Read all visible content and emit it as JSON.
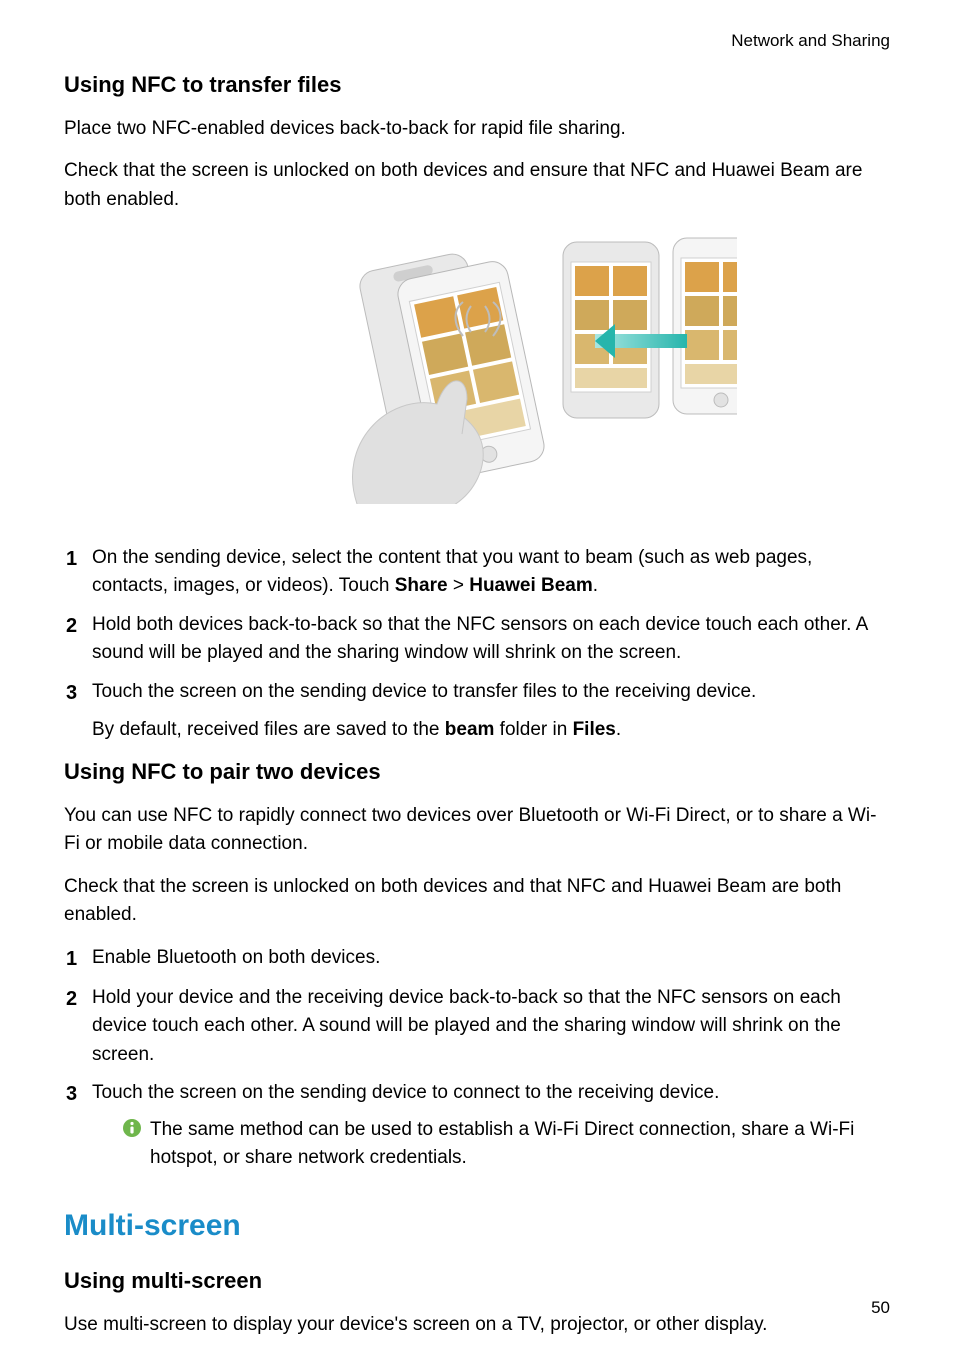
{
  "header": {
    "section": "Network and Sharing"
  },
  "page_number": "50",
  "section1": {
    "heading": "Using NFC to transfer files",
    "p1": "Place two NFC-enabled devices back-to-back for rapid file sharing.",
    "p2": "Check that the screen is unlocked on both devices and ensure that NFC and Huawei Beam are both enabled.",
    "steps": {
      "s1_prefix": "On the sending device, select the content that you want to beam (such as web pages, contacts, images, or videos). Touch ",
      "s1_b1": "Share",
      "s1_mid": " > ",
      "s1_b2": "Huawei Beam",
      "s1_suffix": ".",
      "s2": "Hold both devices back-to-back so that the NFC sensors on each device touch each other. A sound will be played and the sharing window will shrink on the screen.",
      "s3": "Touch the screen on the sending device to transfer files to the receiving device.",
      "s3_p2_prefix": "By default, received files are saved to the ",
      "s3_b1": "beam",
      "s3_mid": " folder in ",
      "s3_b2": "Files",
      "s3_suffix": "."
    }
  },
  "section2": {
    "heading": "Using NFC to pair two devices",
    "p1": "You can use NFC to rapidly connect two devices over Bluetooth or Wi-Fi Direct, or to share a Wi-Fi or mobile data connection.",
    "p2": "Check that the screen is unlocked on both devices and that NFC and Huawei Beam are both enabled.",
    "steps": {
      "s1": "Enable Bluetooth on both devices.",
      "s2": "Hold your device and the receiving device back-to-back so that the NFC sensors on each device touch each other. A sound will be played and the sharing window will shrink on the screen.",
      "s3": "Touch the screen on the sending device to connect to the receiving device."
    },
    "note": "The same method can be used to establish a Wi-Fi Direct connection, share a Wi-Fi hotspot, or share network credentials."
  },
  "section3": {
    "title": "Multi-screen",
    "heading": "Using multi-screen",
    "p1": "Use multi-screen to display your device's screen on a TV, projector, or other display."
  }
}
